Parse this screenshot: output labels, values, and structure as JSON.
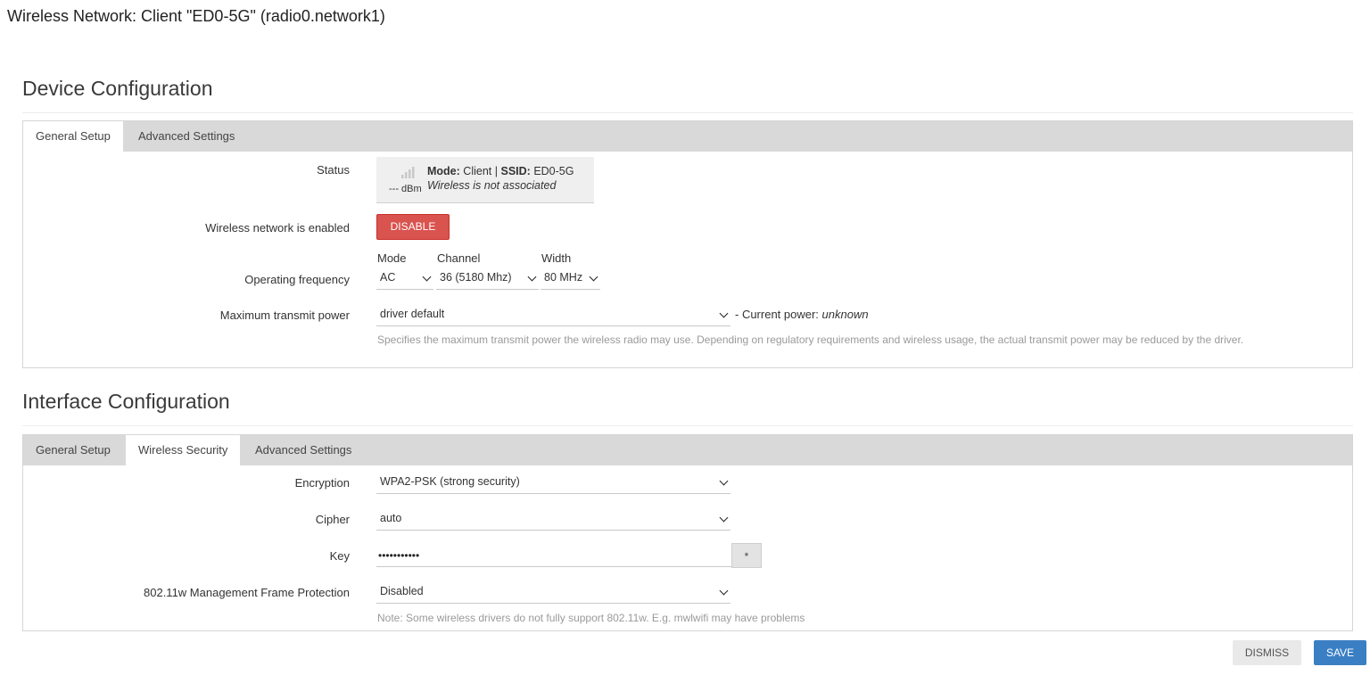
{
  "dialog": {
    "title": "Wireless Network: Client \"ED0-5G\" (radio0.network1)"
  },
  "device": {
    "section_title": "Device Configuration",
    "tabs": [
      {
        "label": "General Setup"
      },
      {
        "label": "Advanced Settings"
      }
    ],
    "status": {
      "label": "Status",
      "signal_icon": "signal-bars-icon",
      "dbm": "--- dBm",
      "mode_key": "Mode:",
      "mode_value": "Client",
      "separator": "|",
      "ssid_key": "SSID:",
      "ssid_value": "ED0-5G",
      "assoc": "Wireless is not associated"
    },
    "enabled": {
      "label": "Wireless network is enabled",
      "button": "DISABLE"
    },
    "frequency": {
      "label": "Operating frequency",
      "mode_label": "Mode",
      "mode_value": "AC",
      "channel_label": "Channel",
      "channel_value": "36 (5180 Mhz)",
      "width_label": "Width",
      "width_value": "80 MHz"
    },
    "txpower": {
      "label": "Maximum transmit power",
      "value": "driver default",
      "current_prefix": "- Current power:",
      "current_value": "unknown",
      "hint": "Specifies the maximum transmit power the wireless radio may use. Depending on regulatory requirements and wireless usage, the actual transmit power may be reduced by the driver."
    }
  },
  "interface": {
    "section_title": "Interface Configuration",
    "tabs": [
      {
        "label": "General Setup"
      },
      {
        "label": "Wireless Security"
      },
      {
        "label": "Advanced Settings"
      }
    ],
    "encryption": {
      "label": "Encryption",
      "value": "WPA2-PSK (strong security)"
    },
    "cipher": {
      "label": "Cipher",
      "value": "auto"
    },
    "key": {
      "label": "Key",
      "value": "•••••••••••",
      "reveal": "*"
    },
    "mfp": {
      "label": "802.11w Management Frame Protection",
      "value": "Disabled",
      "hint": "Note: Some wireless drivers do not fully support 802.11w. E.g. mwlwifi may have problems"
    }
  },
  "footer": {
    "dismiss": "DISMISS",
    "save": "SAVE"
  },
  "colors": {
    "danger": "#d9534f",
    "primary": "#3a7fc4",
    "tabbar": "#d9d9d9"
  }
}
